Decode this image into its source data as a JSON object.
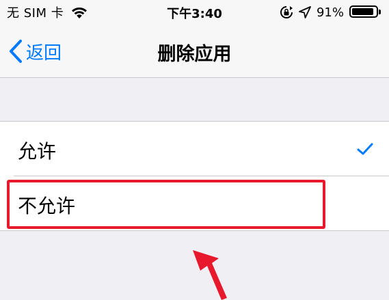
{
  "status_bar": {
    "carrier": "无 SIM 卡",
    "time": "下午3:40",
    "battery_percent": "91%",
    "battery_level": 0.91
  },
  "nav": {
    "back_label": "返回",
    "title": "删除应用"
  },
  "options": [
    {
      "label": "允许",
      "selected": true
    },
    {
      "label": "不允许",
      "selected": false
    }
  ],
  "colors": {
    "accent": "#007aff",
    "annotation": "#e8192c",
    "background": "#efeff4"
  },
  "icons": {
    "wifi": "wifi-icon",
    "rotation_lock": "lock-rotation-icon",
    "location": "location-icon",
    "battery": "battery-icon",
    "back": "back-chevron-icon",
    "check": "checkmark-icon",
    "arrow": "annotation-arrow"
  }
}
